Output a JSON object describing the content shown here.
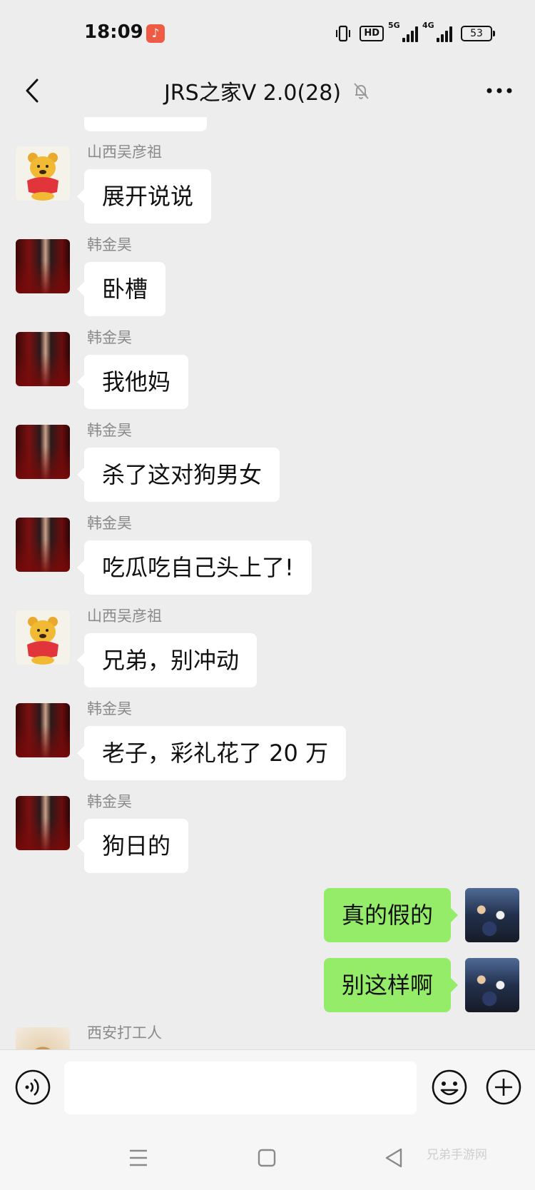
{
  "status_bar": {
    "time": "18:09",
    "network_5g": "5G",
    "network_4g": "4G",
    "hd_label": "HD",
    "battery": "53"
  },
  "header": {
    "title": "JRS之家V 2.0(28)",
    "muted": true
  },
  "messages": [
    {
      "side": "left",
      "sender": "山西吴彦祖",
      "avatar": "pooh-avatar",
      "text": "展开说说"
    },
    {
      "side": "left",
      "sender": "韩金昊",
      "avatar": "dark-photo-avatar",
      "text": "卧槽"
    },
    {
      "side": "left",
      "sender": "韩金昊",
      "avatar": "dark-photo-avatar",
      "text": "我他妈"
    },
    {
      "side": "left",
      "sender": "韩金昊",
      "avatar": "dark-photo-avatar",
      "text": "杀了这对狗男女"
    },
    {
      "side": "left",
      "sender": "韩金昊",
      "avatar": "dark-photo-avatar",
      "text": "吃瓜吃自己头上了!"
    },
    {
      "side": "left",
      "sender": "山西吴彦祖",
      "avatar": "pooh-avatar",
      "text": "兄弟，别冲动"
    },
    {
      "side": "left",
      "sender": "韩金昊",
      "avatar": "dark-photo-avatar",
      "text": "老子，彩礼花了 20 万"
    },
    {
      "side": "left",
      "sender": "韩金昊",
      "avatar": "dark-photo-avatar",
      "text": "狗日的"
    },
    {
      "side": "right",
      "avatar": "basketball-avatar",
      "text": "真的假的"
    },
    {
      "side": "right",
      "avatar": "basketball-avatar",
      "text": "别这样啊"
    },
    {
      "side": "left",
      "sender": "西安打工人",
      "avatar": "dog-avatar",
      "text": ""
    }
  ],
  "input": {
    "value": "",
    "placeholder": ""
  },
  "watermark": "兄弟手游网",
  "colors": {
    "background": "#ededed",
    "bubble_self": "#95ec69",
    "bubble_other": "#ffffff",
    "sender_name": "#8a8a8a"
  }
}
